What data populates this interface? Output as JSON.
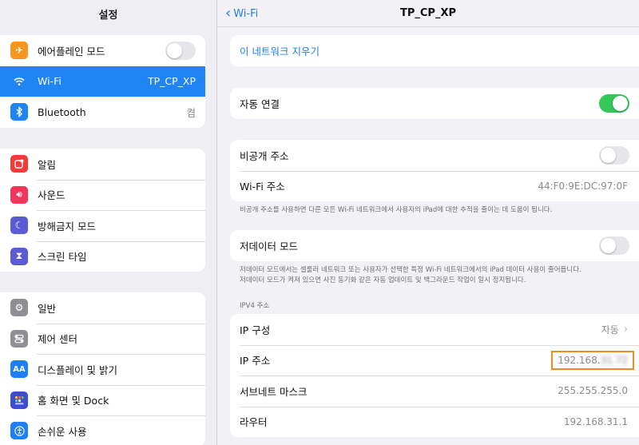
{
  "sidebar": {
    "title": "설정",
    "group1": [
      {
        "label": "에어플레인 모드",
        "icon": "airplane-icon",
        "color": "#f7961e",
        "toggle": false
      },
      {
        "label": "Wi-Fi",
        "icon": "wifi-icon",
        "color": "#1f84f4",
        "value": "TP_CP_XP",
        "active": true
      },
      {
        "label": "Bluetooth",
        "icon": "bluetooth-icon",
        "color": "#1f84f4",
        "value": "켬"
      }
    ],
    "group2": [
      {
        "label": "알림",
        "icon": "notifications-icon",
        "color": "#f23b3b"
      },
      {
        "label": "사운드",
        "icon": "sound-icon",
        "color": "#f2355b"
      },
      {
        "label": "방해금지 모드",
        "icon": "moon-icon",
        "color": "#5b5bd6"
      },
      {
        "label": "스크린 타임",
        "icon": "hourglass-icon",
        "color": "#5b5bd6"
      }
    ],
    "group3": [
      {
        "label": "일반",
        "icon": "gear-icon",
        "color": "#8e8e93"
      },
      {
        "label": "제어 센터",
        "icon": "control-center-icon",
        "color": "#8e8e93"
      },
      {
        "label": "디스플레이 및 밝기",
        "icon": "display-icon",
        "color": "#1f7ef2"
      },
      {
        "label": "홈 화면 및 Dock",
        "icon": "home-screen-icon",
        "color": "#3d4bd6"
      },
      {
        "label": "손쉬운 사용",
        "icon": "accessibility-icon",
        "color": "#1f7ef2"
      }
    ]
  },
  "nav": {
    "back_label": "Wi-Fi",
    "title": "TP_CP_XP"
  },
  "detail": {
    "forget_label": "이 네트워크 지우기",
    "auto_join": {
      "label": "자동 연결",
      "on": true
    },
    "private_address": {
      "label": "비공개 주소",
      "on": false
    },
    "wifi_address": {
      "label": "Wi-Fi 주소",
      "value": "44:F0:9E:DC:97:0F"
    },
    "private_note": "비공개 주소를 사용하면 다른 모든 Wi-Fi 네트워크에서 사용자의 iPad에 대한 추적을 줄이는 데 도움이 됩니다.",
    "low_data": {
      "label": "저데이터 모드",
      "on": false
    },
    "low_data_note_1": "저데이터 모드에서는 셀룰러 네트워크 또는 사용자가 선택한 특정 Wi-Fi 네트워크에서의 iPad 데이터 사용이 줄어듭니다.",
    "low_data_note_2": "저데이터 모드가 켜져 있으면 사진 동기화 같은 자동 업데이트 및 백그라운드 작업이 일시 정지됩니다.",
    "ipv4_header": "IPV4 주소",
    "ip_config": {
      "label": "IP 구성",
      "value": "자동"
    },
    "ip_address": {
      "label": "IP 주소",
      "value_visible": "192.168.",
      "value_blurred": "31.72"
    },
    "subnet": {
      "label": "서브네트 마스크",
      "value": "255.255.255.0"
    },
    "router": {
      "label": "라우터",
      "value": "192.168.31.1"
    }
  },
  "colors": {
    "accent": "#1f84f4",
    "toggle_on": "#34c759",
    "highlight_box": "#f08a24"
  }
}
